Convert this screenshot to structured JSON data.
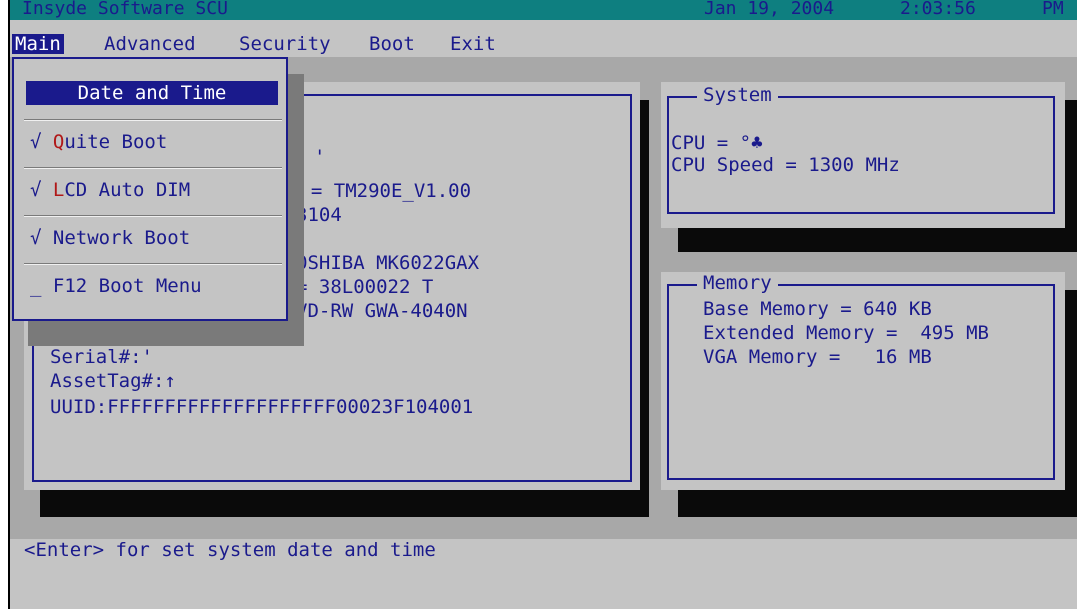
{
  "titlebar": {
    "app": "Insyde Software SCU",
    "date": "Jan 19, 2004",
    "time": "2:03:56",
    "ampm": "PM"
  },
  "menu": {
    "main": "Main",
    "advanced": "Advanced",
    "security": "Security",
    "boot": "Boot",
    "exit": "Exit"
  },
  "dropdown": {
    "selected": "Date and Time",
    "items": [
      {
        "check": "√",
        "hot": "Q",
        "rest": "uite Boot"
      },
      {
        "check": "√",
        "hot": "L",
        "rest": "CD Auto DIM"
      },
      {
        "check": "√",
        "hot": "",
        "rest": "Network Boot"
      },
      {
        "check": "_",
        "hot": "",
        "rest": "F12 Boot Menu"
      }
    ]
  },
  "main_panel": {
    "line_dot": "'",
    "bios_frag": "n = TM290E_V1.00",
    "bios_frag2": "3104",
    "hdd_frag": "OSHIBA MK6022GAX",
    "serial_frag": "= 38L00022 T",
    "optical_frag": "VD-RW GWA-4040N",
    "serial": "Serial#:'",
    "asset": "AssetTag#:↑",
    "uuid": "UUID:FFFFFFFFFFFFFFFFFFFF00023F104001"
  },
  "system": {
    "title": "System",
    "cpu": "CPU = °♣",
    "cpu_speed": "CPU Speed = 1300 MHz"
  },
  "memory": {
    "title": "Memory",
    "base": "Base Memory = 640 KB",
    "extended": "Extended Memory =  495 MB",
    "vga": "VGA Memory =   16 MB"
  },
  "status": {
    "help": "<Enter> for set system date and time"
  }
}
